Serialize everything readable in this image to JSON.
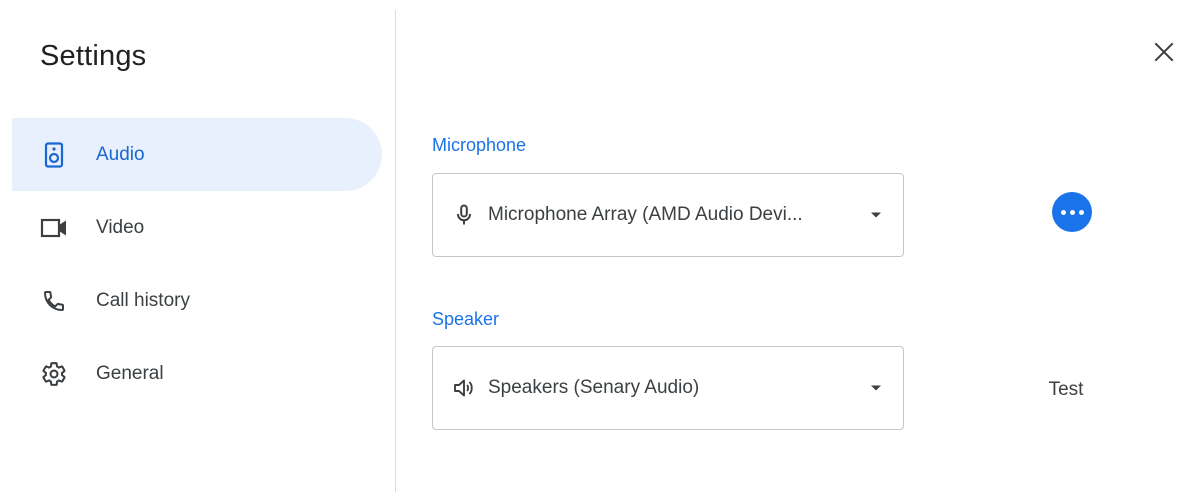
{
  "settings": {
    "title": "Settings"
  },
  "nav": {
    "items": [
      {
        "label": "Audio",
        "icon": "speaker-icon",
        "active": true
      },
      {
        "label": "Video",
        "icon": "video-camera-icon",
        "active": false
      },
      {
        "label": "Call history",
        "icon": "phone-icon",
        "active": false
      },
      {
        "label": "General",
        "icon": "gear-icon",
        "active": false
      }
    ]
  },
  "audio": {
    "microphone": {
      "label": "Microphone",
      "value": "Microphone Array (AMD Audio Devi..."
    },
    "speaker": {
      "label": "Speaker",
      "value": "Speakers (Senary Audio)"
    },
    "test_label": "Test"
  },
  "colors": {
    "accent": "#1a73e8",
    "active_bg": "#e8f0fe",
    "active_text": "#1967d2",
    "text": "#3c4043",
    "border": "#c4c7c5"
  }
}
